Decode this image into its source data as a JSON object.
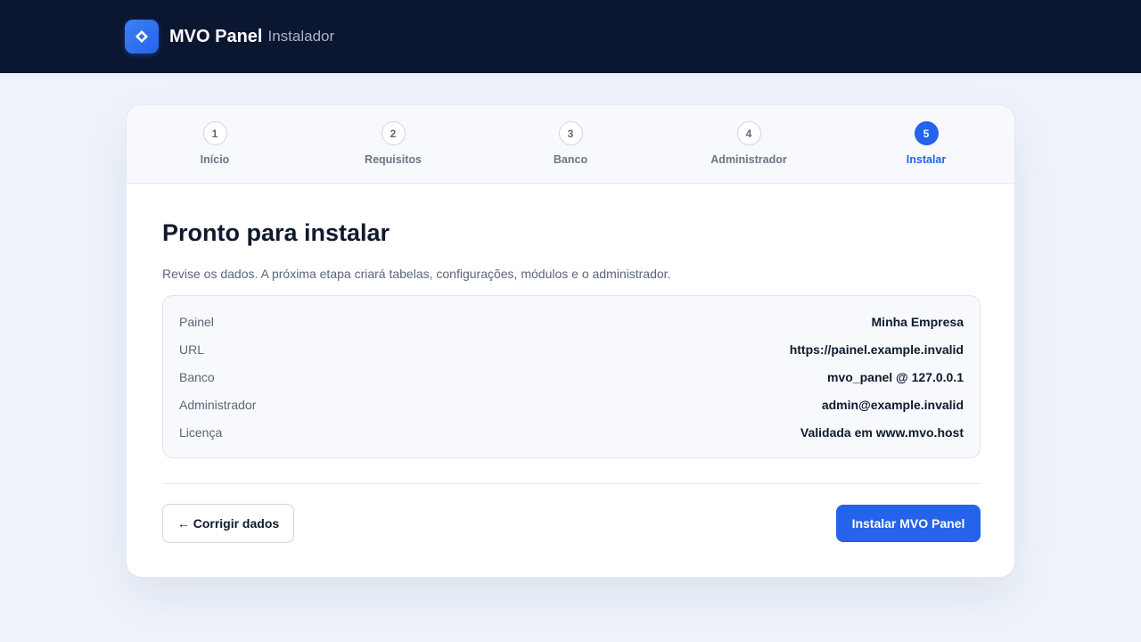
{
  "header": {
    "brand_name": "MVO Panel",
    "brand_sub": "Instalador",
    "logo_icon": "diamond-icon"
  },
  "steps": [
    {
      "number": "1",
      "label": "Início",
      "active": false
    },
    {
      "number": "2",
      "label": "Requisitos",
      "active": false
    },
    {
      "number": "3",
      "label": "Banco",
      "active": false
    },
    {
      "number": "4",
      "label": "Administrador",
      "active": false
    },
    {
      "number": "5",
      "label": "Instalar",
      "active": true
    }
  ],
  "main": {
    "title": "Pronto para instalar",
    "subtitle": "Revise os dados. A próxima etapa criará tabelas, configurações, módulos e o administrador."
  },
  "summary": [
    {
      "label": "Painel",
      "value": "Minha Empresa"
    },
    {
      "label": "URL",
      "value": "https://painel.example.invalid"
    },
    {
      "label": "Banco",
      "value": "mvo_panel @ 127.0.0.1"
    },
    {
      "label": "Administrador",
      "value": "admin@example.invalid"
    },
    {
      "label": "Licença",
      "value": "Validada em www.mvo.host"
    }
  ],
  "actions": {
    "back_label": "← Corrigir dados",
    "install_label": "Instalar MVO Panel"
  },
  "colors": {
    "accent": "#2563eb",
    "header_bg": "#0b1631"
  }
}
